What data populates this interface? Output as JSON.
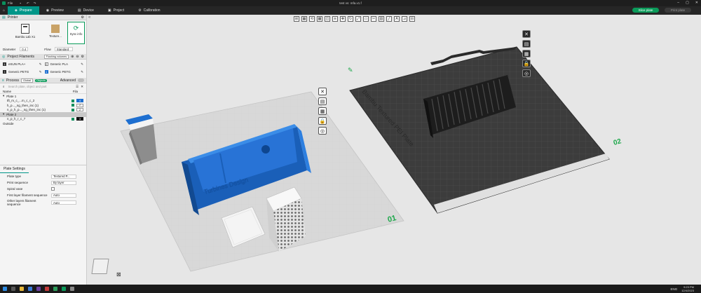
{
  "titlebar": {
    "file_menu": "File",
    "title": "test vs: mfa.v1.f"
  },
  "tabs": [
    {
      "label": "Prepare",
      "icon": "cube-icon"
    },
    {
      "label": "Preview",
      "icon": "eye-icon"
    },
    {
      "label": "Device",
      "icon": "printer-icon"
    },
    {
      "label": "Project",
      "icon": "project-icon"
    },
    {
      "label": "Calibration",
      "icon": "calibration-icon"
    }
  ],
  "slice_label": "Slice plate",
  "print_label": "Print plate",
  "printer": {
    "section_title": "Printer",
    "name": "Bambu Lab X1",
    "plate": "Texture...",
    "sync_label": "Sync info",
    "diameter_label": "Diameter",
    "diameter_value": "0.4",
    "flow_label": "Flow",
    "flow_value": "Standard"
  },
  "filaments": {
    "section_title": "Project Filaments",
    "setting_btn": "Flushing volumes",
    "items": [
      {
        "num": "1",
        "color": "#333333",
        "name": "eSUN PLA+"
      },
      {
        "num": "2",
        "color": "#ffffff",
        "name": "Generic PLA"
      },
      {
        "num": "3",
        "color": "#222222",
        "name": "Generic PETG"
      },
      {
        "num": "4",
        "color": "#1e6fd0",
        "name": "Generic PETG"
      }
    ]
  },
  "process": {
    "section_title": "Process",
    "global_btn": "Global",
    "objects_btn": "Objects",
    "advanced_label": "Advanced",
    "search_placeholder": "Search plate, object and part",
    "col_name": "Name",
    "col_fila": "Fila",
    "tree": [
      {
        "label": "Plate 1",
        "level": 0,
        "selected": false,
        "fila": ""
      },
      {
        "label": "tft_m_c_...m_c_c_2",
        "level": 1,
        "selected": false,
        "fila": "4"
      },
      {
        "label": "h_p..._ng_then_inc (1)",
        "level": 1,
        "selected": false,
        "fila": "2"
      },
      {
        "label": "n_p_h_p..._ng_then_inc (1)",
        "level": 1,
        "selected": false,
        "fila": "2"
      },
      {
        "label": "Plate 2",
        "level": 0,
        "selected": true,
        "fila": ""
      },
      {
        "label": "n_p_h_r_c_7",
        "level": 1,
        "selected": false,
        "fila": "3"
      },
      {
        "label": "Outside",
        "level": 0,
        "selected": false,
        "fila": ""
      }
    ]
  },
  "plate_settings": {
    "title": "Plate Settings",
    "rows": [
      {
        "label": "Plate type",
        "value": "Textured P..."
      },
      {
        "label": "Print sequence",
        "value": "By layer"
      },
      {
        "label": "Spiral vase",
        "value": ""
      },
      {
        "label": "First layer filament sequence",
        "value": "Auto"
      },
      {
        "label": "Other layers filament sequence",
        "value": "Auto"
      }
    ]
  },
  "viewport": {
    "plate1_label": "01",
    "plate2_label": "02",
    "plate2_name": "Bambu Textured PEI Plate",
    "model_text": "Turbines Design"
  },
  "taskbar": {
    "time": "9:23 PM",
    "date": "12/4/2023",
    "lang": "ENG"
  },
  "colors": {
    "accent": "#009688",
    "blue_model": "#1e6fd0",
    "plate_label": "#1ca84a"
  }
}
